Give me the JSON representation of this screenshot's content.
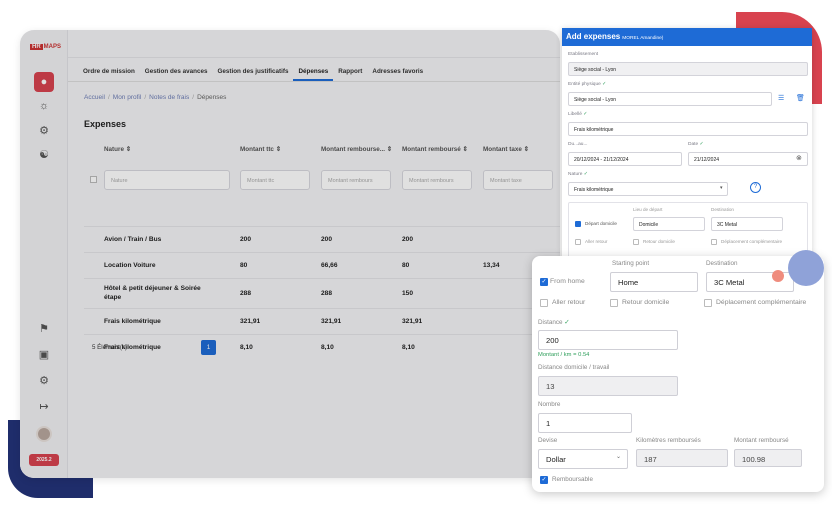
{
  "sidebar": {
    "logo_mark": "HR",
    "logo_text": "MAPS",
    "year_badge": "2025.2",
    "icons": [
      "user-icon",
      "user-pin-icon",
      "user-settings-icon",
      "user-group-icon",
      "bell-icon",
      "image-icon",
      "gear-icon",
      "logout-icon"
    ]
  },
  "tabs": [
    "Ordre de mission",
    "Gestion des avances",
    "Gestion des justificatifs",
    "Dépenses",
    "Rapport",
    "Adresses favoris"
  ],
  "active_tab": "Dépenses",
  "breadcrumb": {
    "items": [
      "Accueil",
      "Mon profil",
      "Notes de frais"
    ],
    "current": "Dépenses",
    "separator": "/"
  },
  "page_title": "Expenses",
  "table": {
    "headers": [
      "Nature",
      "Montant ttc",
      "Montant rembourse...",
      "Montant remboursé",
      "Montant taxe"
    ],
    "sort_icon": "⇕",
    "filters": [
      "Nature",
      "Montant ttc",
      "Montant rembours",
      "Montant rembours",
      "Montant taxe"
    ],
    "rows": [
      [
        "Avion / Train / Bus",
        "200",
        "200",
        "200",
        ""
      ],
      [
        "Location Voiture",
        "80",
        "66,66",
        "80",
        "13,34"
      ],
      [
        "Hôtel & petit déjeuner & Soirée étape",
        "288",
        "288",
        "150",
        ""
      ],
      [
        "Frais kilométrique",
        "321,91",
        "321,91",
        "321,91",
        ""
      ],
      [
        "Frais kilométrique",
        "8,10",
        "8,10",
        "8,10",
        ""
      ]
    ],
    "count_label": "5 Élément(s)",
    "page": "1"
  },
  "panel": {
    "title": "Add expenses",
    "subtitle": "MOREL Amandine)",
    "etablissement_label": "Etablissement",
    "etablissement_value": "Siège social - Lyon",
    "entite_label": "Entité physique",
    "entite_value": "Siège social - Lyon",
    "libelle_label": "Libellé",
    "libelle_value": "Frais kilométrique",
    "du_label": "Du...au...",
    "du_value": "20/12/2024 - 21/12/2024",
    "date_label": "Date",
    "date_value": "21/12/2024",
    "nature_label": "Nature",
    "nature_value": "Frais kilométrique",
    "depart_label": "Départ domicile",
    "lieu_label": "Lieu de départ",
    "lieu_value": "Domicile",
    "destination_label": "Destination",
    "destination_value": "3C Metal",
    "aller_label": "Aller retour",
    "retour_label": "Retour domicile",
    "deplacement_label": "Déplacement complémentaire",
    "check_mark": "✓",
    "list_icon": "☰",
    "trash_icon": "🗑",
    "clear_icon": "⊗",
    "dropdown_icon": "▾",
    "help_icon": "?"
  },
  "zoom": {
    "from_home_label": "From home",
    "starting_label": "Starting point",
    "starting_value": "Home",
    "destination_label": "Destination",
    "destination_value": "3C Metal",
    "aller_label": "Aller retour",
    "retour_label": "Retour domicile",
    "deplacement_label": "Déplacement complémentaire",
    "distance_label": "Distance",
    "distance_value": "200",
    "rate_hint": "Montant / km = 0.54",
    "distance_domicile_label": "Distance domicile / travail",
    "distance_domicile_value": "13",
    "nombre_label": "Nombre",
    "nombre_value": "1",
    "devise_label": "Devise",
    "devise_value": "Dollar",
    "km_label": "Kilomètres remboursés",
    "km_value": "187",
    "montant_label": "Montant remboursé",
    "montant_value": "100.98",
    "remboursable_label": "Remboursable",
    "check_mark": "✓",
    "dropdown_icon": "⌄"
  }
}
